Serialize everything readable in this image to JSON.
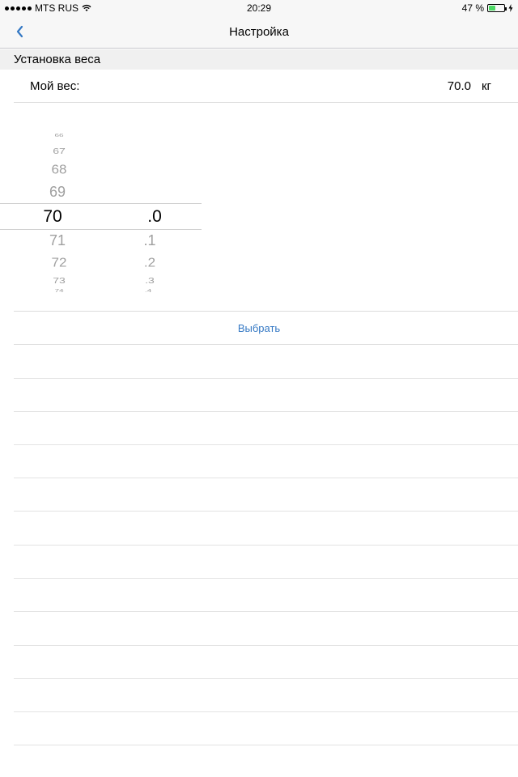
{
  "status_bar": {
    "carrier": "MTS RUS",
    "time": "20:29",
    "battery_text": "47 %",
    "battery_level": 0.47
  },
  "nav": {
    "title": "Настройка"
  },
  "section": {
    "title": "Установка веса"
  },
  "weight_row": {
    "label": "Мой вес:",
    "value": "70.0",
    "unit": "кг"
  },
  "picker": {
    "integer_column": [
      "66",
      "67",
      "68",
      "69",
      "70",
      "71",
      "72",
      "73",
      "74"
    ],
    "decimal_column": [
      ".0",
      ".1",
      ".2",
      ".3",
      ".4"
    ],
    "selected_integer": "70",
    "selected_decimal": ".0"
  },
  "select_button": {
    "label": "Выбрать"
  },
  "colors": {
    "accent": "#3478c4",
    "battery": "#4cd964"
  }
}
